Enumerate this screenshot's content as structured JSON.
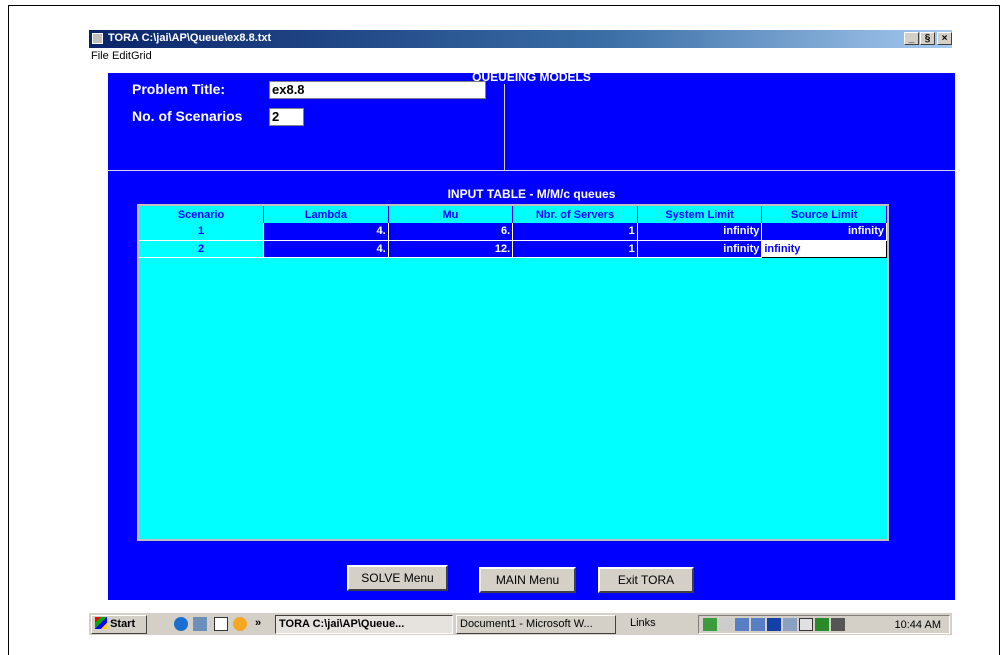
{
  "window": {
    "title": "TORA C:\\jai\\AP\\Queue\\ex8.8.txt",
    "minimize": "_",
    "maximize": "§",
    "close": "×"
  },
  "menu": [
    "File",
    "EditGrid"
  ],
  "header": {
    "title": "QUEUEING MODELS",
    "problem_title_label": "Problem Title:",
    "problem_title_value": "ex8.8",
    "scenarios_label": "No. of Scenarios",
    "scenarios_value": "2"
  },
  "table": {
    "title": "INPUT TABLE - M/M/c queues",
    "columns": [
      "Scenario",
      "Lambda",
      "Mu",
      "Nbr. of Servers",
      "System Limit",
      "Source Limit"
    ],
    "rows": [
      [
        "1",
        "4.",
        "6.",
        "1",
        "infinity",
        "infinity"
      ],
      [
        "2",
        "4.",
        "12.",
        "1",
        "infinity",
        "infinity"
      ]
    ]
  },
  "buttons": {
    "solve": "SOLVE Menu",
    "main": "MAIN Menu",
    "exit": "Exit TORA"
  },
  "taskbar": {
    "start": "Start",
    "chevron": "»",
    "task_tora": "TORA C:\\jai\\AP\\Queue...",
    "task_word": "Document1 - Microsoft W...",
    "links": "Links",
    "clock": "10:44 AM"
  },
  "colors": {
    "client_bg": "#0000ff",
    "grid_bg": "#00ffff",
    "title_gradient_start": "#0a246a"
  }
}
